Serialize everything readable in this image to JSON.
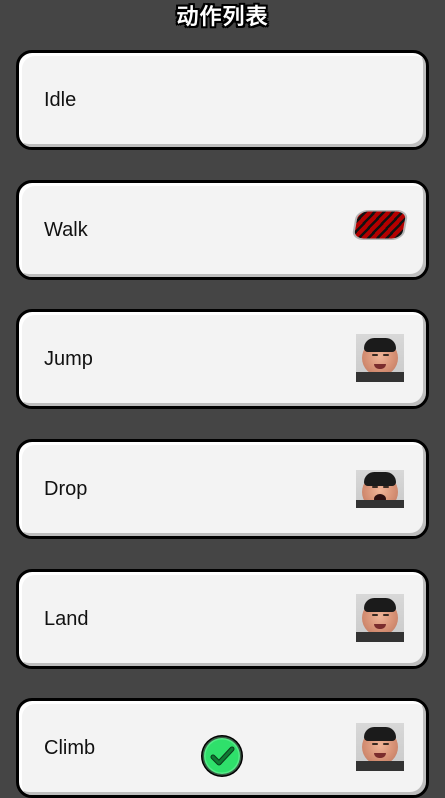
{
  "header": {
    "title": "动作列表"
  },
  "actions": [
    {
      "label": "Idle",
      "thumbnail_icon": ""
    },
    {
      "label": "Walk",
      "thumbnail_icon": "walk-sprite-icon"
    },
    {
      "label": "Jump",
      "thumbnail_icon": "face-thumbnail-icon"
    },
    {
      "label": "Drop",
      "thumbnail_icon": "face-thumbnail-icon"
    },
    {
      "label": "Land",
      "thumbnail_icon": "face-thumbnail-icon"
    },
    {
      "label": "Climb",
      "thumbnail_icon": "face-thumbnail-icon"
    }
  ],
  "colors": {
    "background": "#454545",
    "card_background": "#f3f3f3",
    "card_border": "#000000",
    "check_badge": "#2fe06b"
  },
  "selected_action": "Climb"
}
